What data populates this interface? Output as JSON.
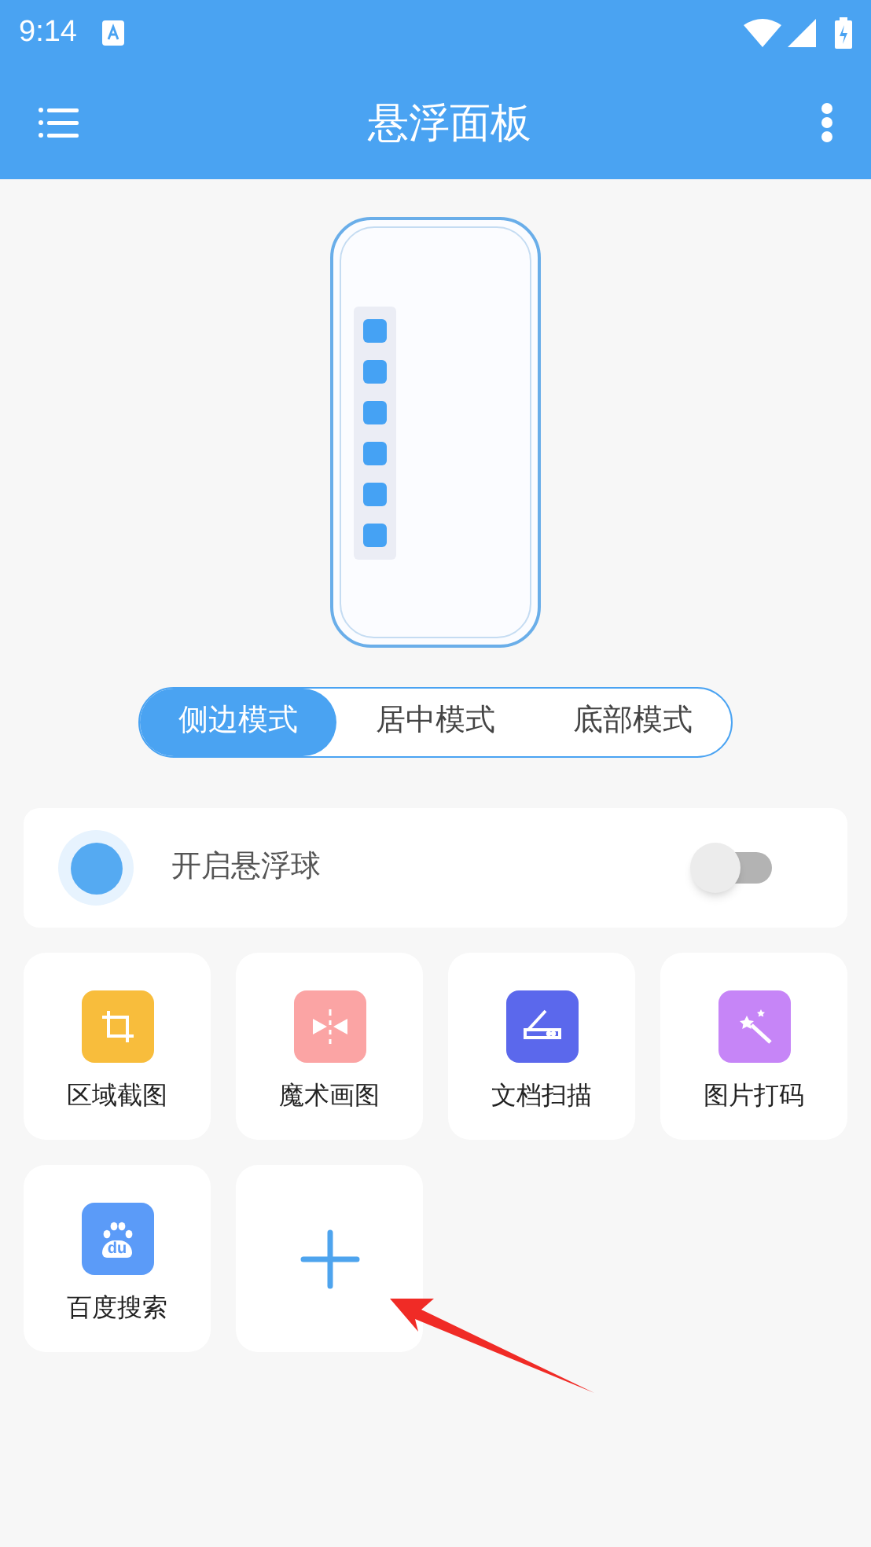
{
  "status_bar": {
    "time": "9:14"
  },
  "toolbar": {
    "title": "悬浮面板"
  },
  "modes": [
    {
      "label": "侧边模式",
      "selected": true
    },
    {
      "label": "居中模式",
      "selected": false
    },
    {
      "label": "底部模式",
      "selected": false
    }
  ],
  "floating_ball": {
    "label": "开启悬浮球",
    "on": false
  },
  "tools": [
    {
      "kind": "tool",
      "label": "区域截图",
      "color": "#f8bd3c"
    },
    {
      "kind": "tool",
      "label": "魔术画图",
      "color": "#fba4a4"
    },
    {
      "kind": "tool",
      "label": "文档扫描",
      "color": "#5b68ec"
    },
    {
      "kind": "tool",
      "label": "图片打码",
      "color": "#c685f7"
    },
    {
      "kind": "tool",
      "label": "百度搜索",
      "color": "#5b9bf8",
      "logo_text": "du"
    },
    {
      "kind": "add"
    }
  ]
}
